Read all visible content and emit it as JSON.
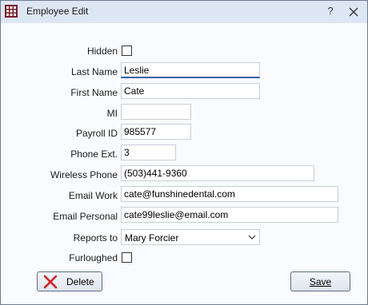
{
  "window": {
    "title": "Employee Edit",
    "help_label": "?"
  },
  "form": {
    "hidden": {
      "label": "Hidden",
      "checked": false
    },
    "last_name": {
      "label": "Last Name",
      "value": "Leslie"
    },
    "first_name": {
      "label": "First Name",
      "value": "Cate"
    },
    "mi": {
      "label": "MI",
      "value": ""
    },
    "payroll_id": {
      "label": "Payroll ID",
      "value": "985577"
    },
    "phone_ext": {
      "label": "Phone Ext.",
      "value": "3"
    },
    "wireless_phone": {
      "label": "Wireless Phone",
      "value": "(503)441-9360"
    },
    "email_work": {
      "label": "Email Work",
      "value": "cate@funshinedental.com"
    },
    "email_personal": {
      "label": "Email Personal",
      "value": "cate99leslie@email.com"
    },
    "reports_to": {
      "label": "Reports to",
      "value": "Mary Forcier"
    },
    "furloughed": {
      "label": "Furloughed",
      "checked": false
    }
  },
  "buttons": {
    "delete_label": "Delete",
    "save_label": "Save"
  },
  "colors": {
    "title_bar": "#dde6f4",
    "delete_icon": "#d42020",
    "focus_underline": "#2a5ea8"
  },
  "icons": {
    "app": "grid-app-icon",
    "help": "help-icon",
    "close": "close-icon",
    "delete": "delete-x-icon",
    "dropdown": "chevron-down-icon"
  }
}
